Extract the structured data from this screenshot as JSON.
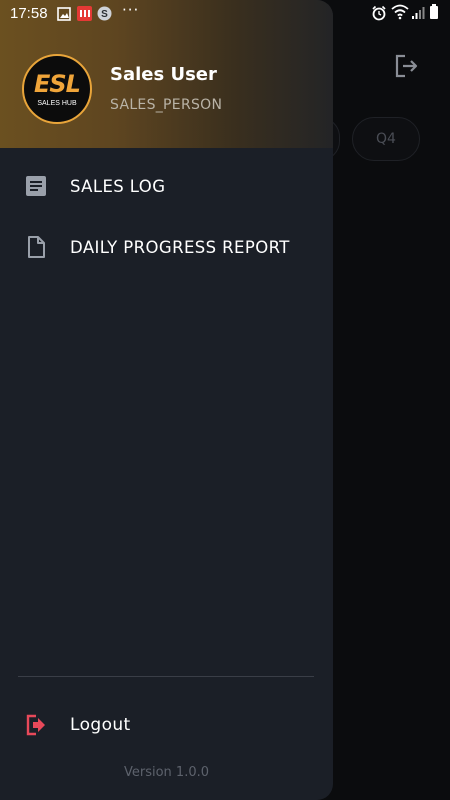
{
  "status_bar": {
    "time": "17:58",
    "dots": "···",
    "left_icons": [
      "image-icon",
      "notification-app-icon",
      "skype-icon"
    ],
    "right_icons": [
      "alarm-icon",
      "wifi-icon",
      "signal-icon",
      "battery-icon"
    ]
  },
  "background": {
    "chips": [
      "Q4"
    ],
    "logout_icon": "logout-icon"
  },
  "drawer": {
    "header": {
      "logo": {
        "text": "ESL",
        "subtext": "SALES HUB"
      },
      "user_name": "Sales User",
      "user_role": "SALES_PERSON"
    },
    "menu": [
      {
        "label": "SALES LOG",
        "icon": "article-icon"
      },
      {
        "label": "DAILY PROGRESS REPORT",
        "icon": "document-icon"
      }
    ],
    "logout": {
      "label": "Logout",
      "icon": "logout-icon"
    },
    "version": "Version 1.0.0"
  },
  "colors": {
    "drawer_bg": "#1b1f27",
    "header_gold": "#6b5020",
    "logo_orange": "#f0a53a",
    "logout_red": "#e8495a"
  }
}
